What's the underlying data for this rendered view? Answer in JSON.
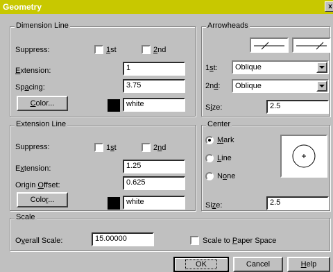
{
  "window": {
    "title": "Geometry",
    "close_glyph": "x"
  },
  "dimension_line": {
    "title": "Dimension Line",
    "suppress_label": "Suppress:",
    "first_label_pre": "",
    "first_label_u": "1",
    "first_label_post": "st",
    "second_label_pre": "",
    "second_label_u": "2",
    "second_label_post": "nd",
    "first_checked": false,
    "second_checked": false,
    "extension_pre": "",
    "extension_u": "E",
    "extension_post": "xtension:",
    "extension_value": "1",
    "spacing_pre": "Sp",
    "spacing_u": "a",
    "spacing_post": "cing:",
    "spacing_value": "3.75",
    "color_pre": "",
    "color_u": "C",
    "color_post": "olor...",
    "color_value": "white",
    "swatch_color": "#000000"
  },
  "extension_line": {
    "title": "Extension Line",
    "suppress_label": "Suppress:",
    "first_label_pre": "1",
    "first_label_u": "s",
    "first_label_post": "t",
    "second_label_pre": "2",
    "second_label_u": "n",
    "second_label_post": "d",
    "first_checked": false,
    "second_checked": false,
    "extension_pre": "E",
    "extension_u": "x",
    "extension_post": "tension:",
    "extension_value": "1.25",
    "origin_pre": "Origin ",
    "origin_u": "O",
    "origin_post": "ffset:",
    "origin_value": "0.625",
    "color_pre": "Colo",
    "color_u": "r",
    "color_post": "...",
    "color_value": "white",
    "swatch_color": "#000000"
  },
  "arrowheads": {
    "title": "Arrowheads",
    "first_pre": "1",
    "first_u": "s",
    "first_post": "t:",
    "first_value": "Oblique",
    "second_pre": "2n",
    "second_u": "d",
    "second_post": ":",
    "second_value": "Oblique",
    "size_pre": "S",
    "size_u": "i",
    "size_post": "ze:",
    "size_value": "2.5"
  },
  "center": {
    "title": "Center",
    "mark_pre": "",
    "mark_u": "M",
    "mark_post": "ark",
    "line_pre": "",
    "line_u": "L",
    "line_post": "ine",
    "none_pre": "N",
    "none_u": "o",
    "none_post": "ne",
    "selected": "mark",
    "size_pre": "Si",
    "size_u": "z",
    "size_post": "e:",
    "size_value": "2.5"
  },
  "scale": {
    "title": "Scale",
    "overall_pre": "O",
    "overall_u": "v",
    "overall_post": "erall Scale:",
    "overall_value": "15.00000",
    "paper_pre": "Scale to ",
    "paper_u": "P",
    "paper_post": "aper Space",
    "paper_checked": false
  },
  "buttons": {
    "ok_label": "OK",
    "cancel_label": "Cancel",
    "help_pre": "",
    "help_u": "H",
    "help_post": "elp"
  }
}
